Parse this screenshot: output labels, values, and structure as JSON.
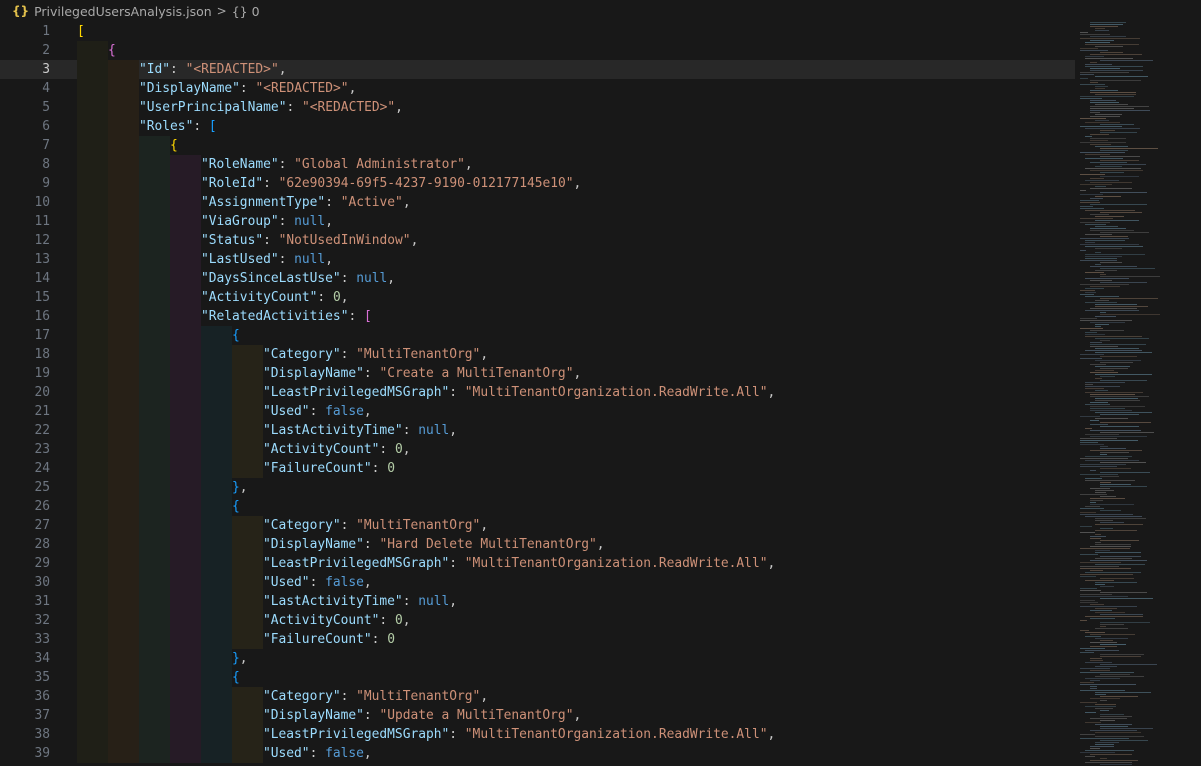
{
  "breadcrumb": {
    "file_icon": "{}",
    "file_name": "PrivilegedUsersAnalysis.json",
    "separator": ">",
    "node_icon": "{}",
    "node_label": "0"
  },
  "editor": {
    "current_line": 3,
    "lines": [
      {
        "n": 1,
        "indent": 0,
        "tokens": [
          [
            "br0",
            "["
          ]
        ]
      },
      {
        "n": 2,
        "indent": 1,
        "tokens": [
          [
            "br1",
            "{"
          ]
        ]
      },
      {
        "n": 3,
        "indent": 2,
        "tokens": [
          [
            "key",
            "\"Id\""
          ],
          [
            "punct",
            ": "
          ],
          [
            "str",
            "\"<REDACTED>\""
          ],
          [
            "punct",
            ","
          ]
        ]
      },
      {
        "n": 4,
        "indent": 2,
        "tokens": [
          [
            "key",
            "\"DisplayName\""
          ],
          [
            "punct",
            ": "
          ],
          [
            "str",
            "\"<REDACTED>\""
          ],
          [
            "punct",
            ","
          ]
        ]
      },
      {
        "n": 5,
        "indent": 2,
        "tokens": [
          [
            "key",
            "\"UserPrincipalName\""
          ],
          [
            "punct",
            ": "
          ],
          [
            "str",
            "\"<REDACTED>\""
          ],
          [
            "punct",
            ","
          ]
        ]
      },
      {
        "n": 6,
        "indent": 2,
        "tokens": [
          [
            "key",
            "\"Roles\""
          ],
          [
            "punct",
            ": "
          ],
          [
            "br2",
            "["
          ]
        ]
      },
      {
        "n": 7,
        "indent": 3,
        "tokens": [
          [
            "br0",
            "{"
          ]
        ]
      },
      {
        "n": 8,
        "indent": 4,
        "tokens": [
          [
            "key",
            "\"RoleName\""
          ],
          [
            "punct",
            ": "
          ],
          [
            "str",
            "\"Global Administrator\""
          ],
          [
            "punct",
            ","
          ]
        ]
      },
      {
        "n": 9,
        "indent": 4,
        "tokens": [
          [
            "key",
            "\"RoleId\""
          ],
          [
            "punct",
            ": "
          ],
          [
            "str",
            "\"62e90394-69f5-4237-9190-012177145e10\""
          ],
          [
            "punct",
            ","
          ]
        ]
      },
      {
        "n": 10,
        "indent": 4,
        "tokens": [
          [
            "key",
            "\"AssignmentType\""
          ],
          [
            "punct",
            ": "
          ],
          [
            "str",
            "\"Active\""
          ],
          [
            "punct",
            ","
          ]
        ]
      },
      {
        "n": 11,
        "indent": 4,
        "tokens": [
          [
            "key",
            "\"ViaGroup\""
          ],
          [
            "punct",
            ": "
          ],
          [
            "bool",
            "null"
          ],
          [
            "punct",
            ","
          ]
        ]
      },
      {
        "n": 12,
        "indent": 4,
        "tokens": [
          [
            "key",
            "\"Status\""
          ],
          [
            "punct",
            ": "
          ],
          [
            "str",
            "\"NotUsedInWindow\""
          ],
          [
            "punct",
            ","
          ]
        ]
      },
      {
        "n": 13,
        "indent": 4,
        "tokens": [
          [
            "key",
            "\"LastUsed\""
          ],
          [
            "punct",
            ": "
          ],
          [
            "bool",
            "null"
          ],
          [
            "punct",
            ","
          ]
        ]
      },
      {
        "n": 14,
        "indent": 4,
        "tokens": [
          [
            "key",
            "\"DaysSinceLastUse\""
          ],
          [
            "punct",
            ": "
          ],
          [
            "bool",
            "null"
          ],
          [
            "punct",
            ","
          ]
        ]
      },
      {
        "n": 15,
        "indent": 4,
        "tokens": [
          [
            "key",
            "\"ActivityCount\""
          ],
          [
            "punct",
            ": "
          ],
          [
            "num",
            "0"
          ],
          [
            "punct",
            ","
          ]
        ]
      },
      {
        "n": 16,
        "indent": 4,
        "tokens": [
          [
            "key",
            "\"RelatedActivities\""
          ],
          [
            "punct",
            ": "
          ],
          [
            "br1",
            "["
          ]
        ]
      },
      {
        "n": 17,
        "indent": 5,
        "tokens": [
          [
            "br2",
            "{"
          ]
        ]
      },
      {
        "n": 18,
        "indent": 6,
        "tokens": [
          [
            "key",
            "\"Category\""
          ],
          [
            "punct",
            ": "
          ],
          [
            "str",
            "\"MultiTenantOrg\""
          ],
          [
            "punct",
            ","
          ]
        ]
      },
      {
        "n": 19,
        "indent": 6,
        "tokens": [
          [
            "key",
            "\"DisplayName\""
          ],
          [
            "punct",
            ": "
          ],
          [
            "str",
            "\"Create a MultiTenantOrg\""
          ],
          [
            "punct",
            ","
          ]
        ]
      },
      {
        "n": 20,
        "indent": 6,
        "tokens": [
          [
            "key",
            "\"LeastPrivilegedMSGraph\""
          ],
          [
            "punct",
            ": "
          ],
          [
            "str",
            "\"MultiTenantOrganization.ReadWrite.All\""
          ],
          [
            "punct",
            ","
          ]
        ]
      },
      {
        "n": 21,
        "indent": 6,
        "tokens": [
          [
            "key",
            "\"Used\""
          ],
          [
            "punct",
            ": "
          ],
          [
            "bool",
            "false"
          ],
          [
            "punct",
            ","
          ]
        ]
      },
      {
        "n": 22,
        "indent": 6,
        "tokens": [
          [
            "key",
            "\"LastActivityTime\""
          ],
          [
            "punct",
            ": "
          ],
          [
            "bool",
            "null"
          ],
          [
            "punct",
            ","
          ]
        ]
      },
      {
        "n": 23,
        "indent": 6,
        "tokens": [
          [
            "key",
            "\"ActivityCount\""
          ],
          [
            "punct",
            ": "
          ],
          [
            "num",
            "0"
          ],
          [
            "punct",
            ","
          ]
        ]
      },
      {
        "n": 24,
        "indent": 6,
        "tokens": [
          [
            "key",
            "\"FailureCount\""
          ],
          [
            "punct",
            ": "
          ],
          [
            "num",
            "0"
          ]
        ]
      },
      {
        "n": 25,
        "indent": 5,
        "tokens": [
          [
            "br2",
            "}"
          ],
          [
            "punct",
            ","
          ]
        ]
      },
      {
        "n": 26,
        "indent": 5,
        "tokens": [
          [
            "br2",
            "{"
          ]
        ]
      },
      {
        "n": 27,
        "indent": 6,
        "tokens": [
          [
            "key",
            "\"Category\""
          ],
          [
            "punct",
            ": "
          ],
          [
            "str",
            "\"MultiTenantOrg\""
          ],
          [
            "punct",
            ","
          ]
        ]
      },
      {
        "n": 28,
        "indent": 6,
        "tokens": [
          [
            "key",
            "\"DisplayName\""
          ],
          [
            "punct",
            ": "
          ],
          [
            "str",
            "\"Hard Delete MultiTenantOrg\""
          ],
          [
            "punct",
            ","
          ]
        ]
      },
      {
        "n": 29,
        "indent": 6,
        "tokens": [
          [
            "key",
            "\"LeastPrivilegedMSGraph\""
          ],
          [
            "punct",
            ": "
          ],
          [
            "str",
            "\"MultiTenantOrganization.ReadWrite.All\""
          ],
          [
            "punct",
            ","
          ]
        ]
      },
      {
        "n": 30,
        "indent": 6,
        "tokens": [
          [
            "key",
            "\"Used\""
          ],
          [
            "punct",
            ": "
          ],
          [
            "bool",
            "false"
          ],
          [
            "punct",
            ","
          ]
        ]
      },
      {
        "n": 31,
        "indent": 6,
        "tokens": [
          [
            "key",
            "\"LastActivityTime\""
          ],
          [
            "punct",
            ": "
          ],
          [
            "bool",
            "null"
          ],
          [
            "punct",
            ","
          ]
        ]
      },
      {
        "n": 32,
        "indent": 6,
        "tokens": [
          [
            "key",
            "\"ActivityCount\""
          ],
          [
            "punct",
            ": "
          ],
          [
            "num",
            "0"
          ],
          [
            "punct",
            ","
          ]
        ]
      },
      {
        "n": 33,
        "indent": 6,
        "tokens": [
          [
            "key",
            "\"FailureCount\""
          ],
          [
            "punct",
            ": "
          ],
          [
            "num",
            "0"
          ]
        ]
      },
      {
        "n": 34,
        "indent": 5,
        "tokens": [
          [
            "br2",
            "}"
          ],
          [
            "punct",
            ","
          ]
        ]
      },
      {
        "n": 35,
        "indent": 5,
        "tokens": [
          [
            "br2",
            "{"
          ]
        ]
      },
      {
        "n": 36,
        "indent": 6,
        "tokens": [
          [
            "key",
            "\"Category\""
          ],
          [
            "punct",
            ": "
          ],
          [
            "str",
            "\"MultiTenantOrg\""
          ],
          [
            "punct",
            ","
          ]
        ]
      },
      {
        "n": 37,
        "indent": 6,
        "tokens": [
          [
            "key",
            "\"DisplayName\""
          ],
          [
            "punct",
            ": "
          ],
          [
            "str",
            "\"Update a MultiTenantOrg\""
          ],
          [
            "punct",
            ","
          ]
        ]
      },
      {
        "n": 38,
        "indent": 6,
        "tokens": [
          [
            "key",
            "\"LeastPrivilegedMSGraph\""
          ],
          [
            "punct",
            ": "
          ],
          [
            "str",
            "\"MultiTenantOrganization.ReadWrite.All\""
          ],
          [
            "punct",
            ","
          ]
        ]
      },
      {
        "n": 39,
        "indent": 6,
        "tokens": [
          [
            "key",
            "\"Used\""
          ],
          [
            "punct",
            ": "
          ],
          [
            "bool",
            "false"
          ],
          [
            "punct",
            ","
          ]
        ]
      }
    ]
  },
  "colors": {
    "background": "#181818",
    "current_line": "#282828",
    "key": "#9cdcfe",
    "string": "#ce9178",
    "number": "#b5cea8",
    "keyword": "#569cd6",
    "bracket_level_1": "#ffd700",
    "bracket_level_2": "#da70d6",
    "bracket_level_3": "#179fff",
    "indent_rainbow": [
      "#1f1f17",
      "#272017",
      "#1c2420",
      "#261b26",
      "#172225",
      "#262318"
    ]
  }
}
